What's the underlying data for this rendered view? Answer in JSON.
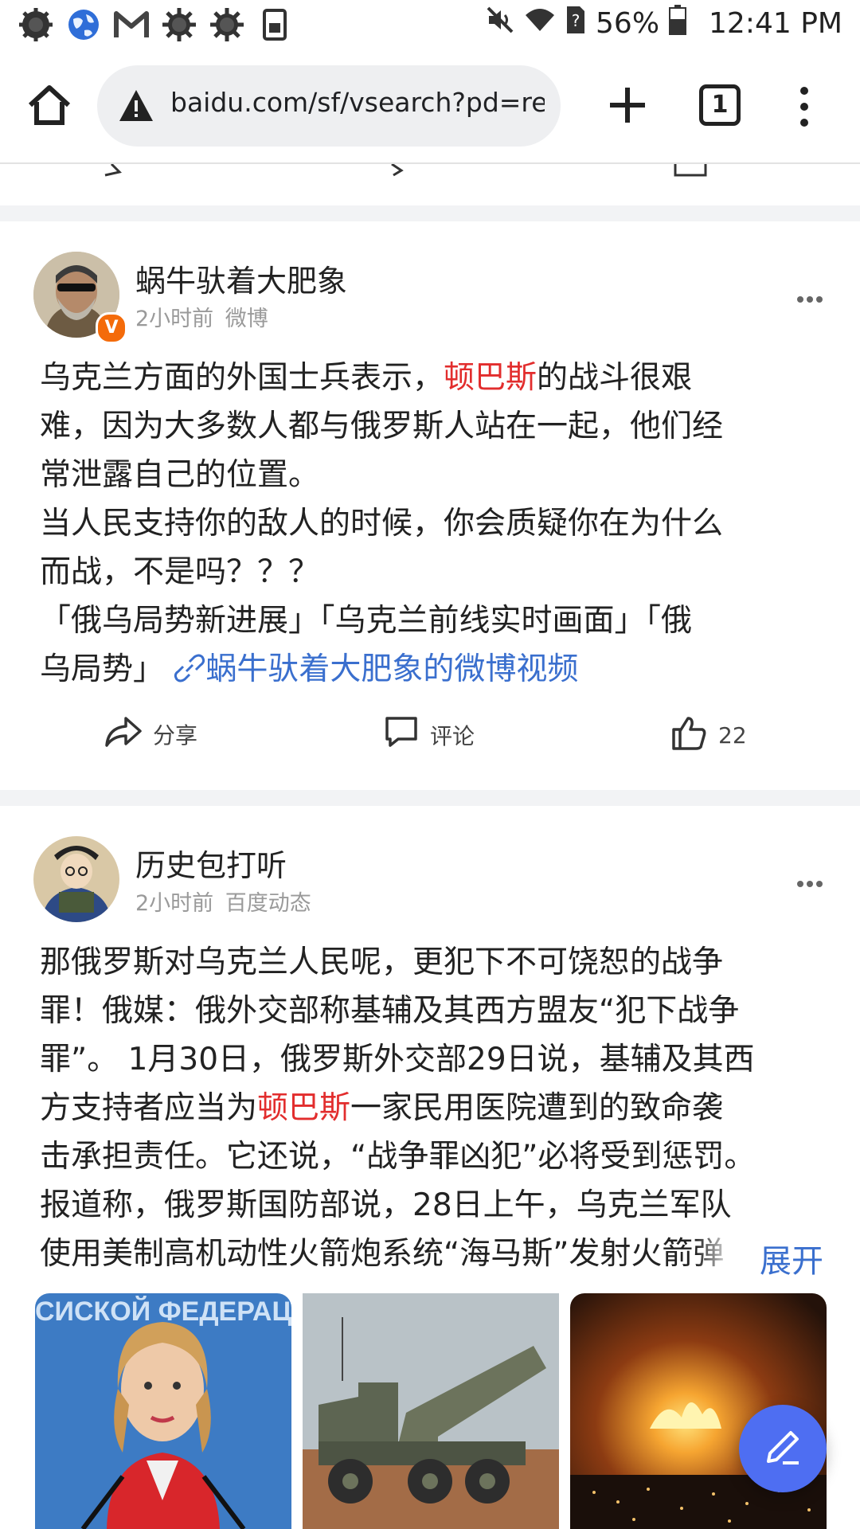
{
  "status_bar": {
    "battery": "56%",
    "time": "12:41 PM"
  },
  "browser": {
    "url": "baidu.com/sf/vsearch?pd=rea",
    "tab_count": "1"
  },
  "posts": [
    {
      "author": "蜗牛驮着大肥象",
      "time": "2小时前",
      "source": "微博",
      "verified_badge": "V",
      "text_lines": {
        "l1a": "乌克兰方面的外国士兵表示，",
        "l1h": "顿巴斯",
        "l1b": "的战斗很艰",
        "l2": "难，因为大多数人都与俄罗斯人站在一起，他们经",
        "l3": "常泄露自己的位置。",
        "l4": "当人民支持你的敌人的时候，你会质疑你在为什么",
        "l5": "而战，不是吗？？？",
        "l6": "「俄乌局势新进展」「乌克兰前线实时画面」「俄",
        "l7a": "乌局势」",
        "l7link": "蜗牛驮着大肥象的微博视频"
      },
      "actions": {
        "share": "分享",
        "comment": "评论",
        "like_count": "22"
      }
    },
    {
      "author": "历史包打听",
      "time": "2小时前",
      "source": "百度动态",
      "text_lines": {
        "l1": "那俄罗斯对乌克兰人民呢，更犯下不可饶恕的战争",
        "l2": "罪！俄媒：俄外交部称基辅及其西方盟友“犯下战争",
        "l3": "罪”。 1月30日，俄罗斯外交部29日说，基辅及其西",
        "l4a": "方支持者应当为",
        "l4h": "顿巴斯",
        "l4b": "一家民用医院遭到的致命袭",
        "l5": "击承担责任。它还说，“战争罪凶犯”必将受到惩罚。",
        "l6": "报道称，俄罗斯国防部说，28日上午，乌克兰军队",
        "l7": "使用美制高机动性火箭炮系统“海马斯”发射火箭弹"
      },
      "expand_label": "展开",
      "image_caption_text": "СИСКОЙ ФЕДЕРАЦ"
    }
  ],
  "colors": {
    "highlight": "#e22d2d",
    "link": "#3a6fce",
    "fab": "#4e6ef2",
    "separator": "#f2f3f5"
  },
  "icons": [
    "gear-icon",
    "globe-icon",
    "gmail-icon",
    "gear-icon",
    "gear-icon",
    "dictionary-icon",
    "mute-icon",
    "wifi-icon",
    "sim-unknown-icon",
    "battery-icon",
    "home-icon",
    "warning-icon",
    "plus-icon",
    "tabs-icon",
    "menu-icon",
    "more-icon",
    "share-icon",
    "comment-icon",
    "like-icon",
    "link-icon",
    "edit-icon"
  ]
}
